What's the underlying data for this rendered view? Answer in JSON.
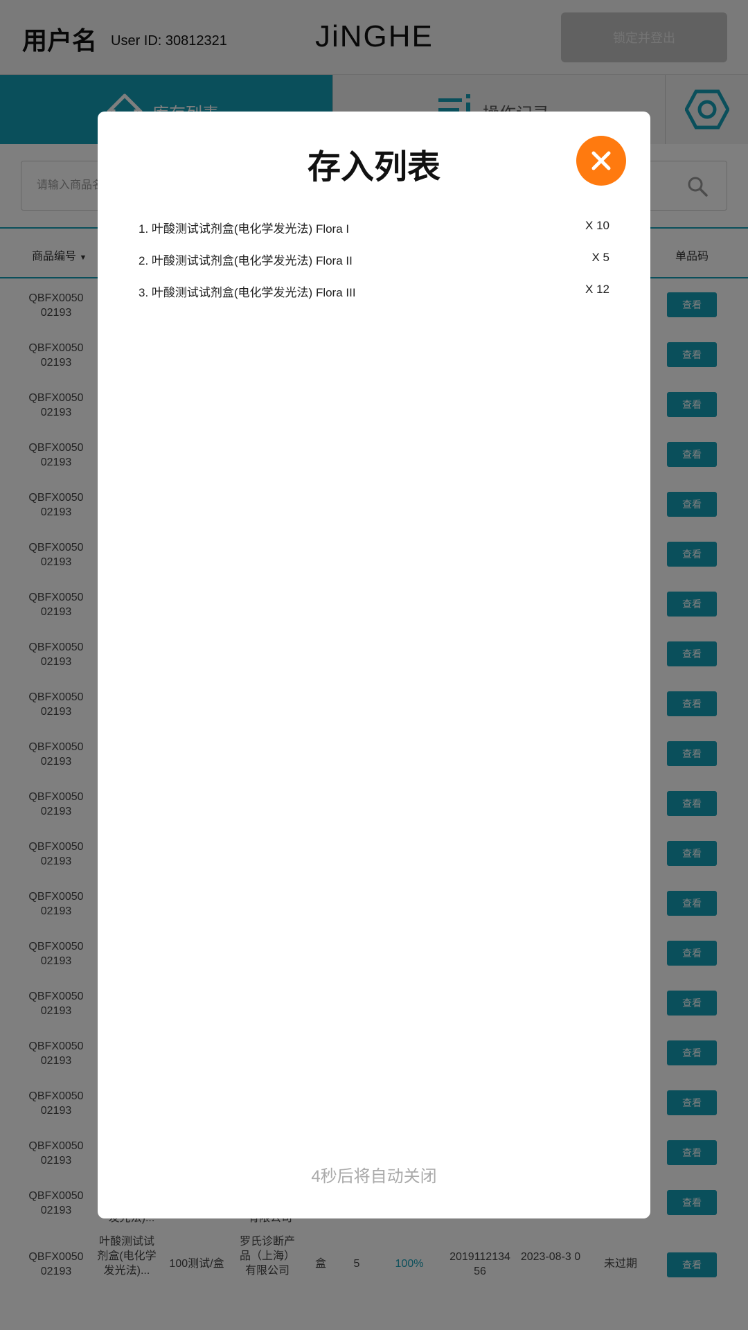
{
  "header": {
    "username": "用户名",
    "user_id": "User ID: 30812321",
    "logo": "JiNGHE",
    "lock_logout_label": "锁定并登出"
  },
  "tabs": {
    "inventory_label": "库存列表",
    "records_label": "操作记录",
    "inventory_icon": "home-icon",
    "records_icon": "list-icon",
    "settings_icon": "settings-icon"
  },
  "search": {
    "placeholder": "请输入商品名"
  },
  "table": {
    "headers": {
      "code": "商品编号",
      "barcode": "单品码"
    },
    "view_label": "查看",
    "rows": [
      {
        "code": "QBFX0050 02193"
      },
      {
        "code": "QBFX0050 02193"
      },
      {
        "code": "QBFX0050 02193"
      },
      {
        "code": "QBFX0050 02193"
      },
      {
        "code": "QBFX0050 02193"
      },
      {
        "code": "QBFX0050 02193"
      },
      {
        "code": "QBFX0050 02193"
      },
      {
        "code": "QBFX0050 02193"
      },
      {
        "code": "QBFX0050 02193"
      },
      {
        "code": "QBFX0050 02193"
      },
      {
        "code": "QBFX0050 02193"
      },
      {
        "code": "QBFX0050 02193"
      },
      {
        "code": "QBFX0050 02193"
      },
      {
        "code": "QBFX0050 02193"
      },
      {
        "code": "QBFX0050 02193"
      },
      {
        "code": "QBFX0050 02193"
      },
      {
        "code": "QBFX0050 02193"
      },
      {
        "code": "QBFX0050 02193"
      },
      {
        "code": "QBFX0050 02193"
      }
    ],
    "last_row": {
      "code": "QBFX0050 02193",
      "name": "叶酸测试试剂盒(电化学发光法)...",
      "spec": "100测试/盒",
      "maker": "罗氏诊断产品（上海）有限公司",
      "unit": "盒",
      "qty": "5",
      "percent": "100%",
      "batch": "2019112134 56",
      "expiry": "2023-08-3 0",
      "status": "未过期"
    },
    "partial_row_maker_tail": "有限公司",
    "partial_row_name_tail": "发光法)..."
  },
  "modal": {
    "title": "存入列表",
    "close_icon": "close-icon",
    "items": [
      {
        "name": "1. 叶酸测试试剂盒(电化学发光法) Flora I",
        "qty": "X 10"
      },
      {
        "name": "2. 叶酸测试试剂盒(电化学发光法) Flora II",
        "qty": "X 5"
      },
      {
        "name": "3. 叶酸测试试剂盒(电化学发光法) Flora III",
        "qty": "X 12"
      }
    ],
    "countdown": "4秒后将自动关闭"
  },
  "colors": {
    "teal": "#159fb6",
    "orange": "#ff7a0f",
    "overlay": "rgba(0,0,0,0.5)"
  }
}
